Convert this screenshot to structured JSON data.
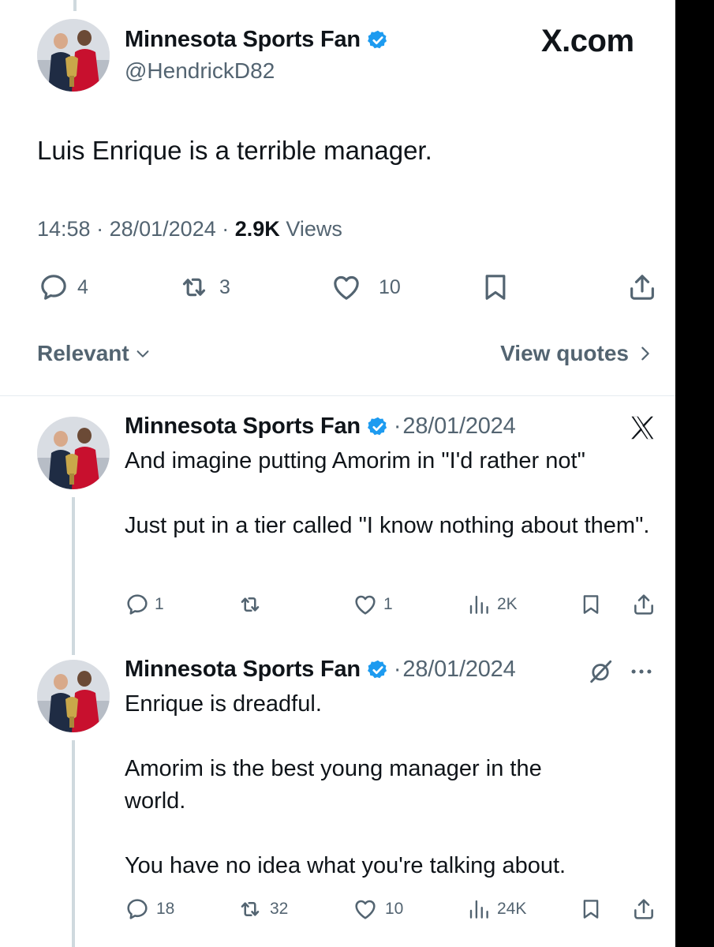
{
  "main_tweet": {
    "author_name": "Minnesota Sports Fan",
    "handle": "@HendrickD82",
    "watermark": "X.com",
    "text": "Luis Enrique is a terrible manager.",
    "time": "14:58",
    "date": "28/01/2024",
    "views_count": "2.9K",
    "views_label": "Views",
    "replies": "4",
    "reposts": "3",
    "likes": "10"
  },
  "sort": {
    "label": "Relevant",
    "quotes_label": "View quotes"
  },
  "replies": [
    {
      "author_name": "Minnesota Sports Fan",
      "date": "28/01/2024",
      "paragraphs": [
        "And imagine putting Amorim in \"I'd rather not\"",
        "Just put in a tier called \"I know nothing about them\"."
      ],
      "replies": "1",
      "reposts": "",
      "likes": "1",
      "views": "2K"
    },
    {
      "author_name": "Minnesota Sports Fan",
      "date": "28/01/2024",
      "paragraphs": [
        "Enrique is dreadful.",
        "Amorim is the best young manager in the world.",
        "You have no idea what you're talking about."
      ],
      "replies": "18",
      "reposts": "32",
      "likes": "10",
      "views": "24K"
    }
  ],
  "colors": {
    "verified": "#1d9bf0",
    "muted": "#536471",
    "text": "#0f1419"
  },
  "icons": [
    "verified-badge-icon",
    "reply-icon",
    "repost-icon",
    "like-icon",
    "bookmark-icon",
    "share-icon",
    "views-icon",
    "chevron-down-icon",
    "chevron-right-icon",
    "x-logo-icon",
    "grok-icon",
    "more-icon"
  ]
}
